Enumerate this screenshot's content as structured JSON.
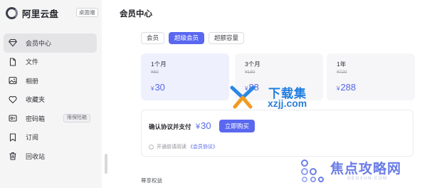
{
  "app": {
    "name": "阿里云盘",
    "edition_badge": "桌面端"
  },
  "sidebar": {
    "items": [
      {
        "label": "会员中心",
        "icon": "diamond-icon",
        "active": true
      },
      {
        "label": "文件",
        "icon": "file-icon"
      },
      {
        "label": "相册",
        "icon": "photo-icon"
      },
      {
        "label": "收藏夹",
        "icon": "heart-icon"
      },
      {
        "label": "密码箱",
        "icon": "safe-icon",
        "tag": "限保险箱"
      },
      {
        "label": "订阅",
        "icon": "bookmark-icon"
      },
      {
        "label": "回收站",
        "icon": "trash-icon"
      }
    ]
  },
  "main": {
    "title": "会员中心",
    "tabs": [
      {
        "label": "会员",
        "active": false
      },
      {
        "label": "超级会员",
        "active": true
      },
      {
        "label": "超额容量",
        "active": false
      }
    ],
    "plans": [
      {
        "name": "1个月",
        "original": "¥60",
        "currency": "¥",
        "price": "30",
        "selected": true
      },
      {
        "name": "3个月",
        "original": "¥180",
        "currency": "¥",
        "price": "88",
        "selected": false
      },
      {
        "name": "1年",
        "original": "¥720",
        "currency": "¥",
        "price": "288",
        "selected": false
      }
    ],
    "payment": {
      "label": "确认协议并支付",
      "currency": "¥",
      "price": "30",
      "button": "立即购买",
      "agree_text": "开通前请阅读",
      "agree_link": "《会员协议》"
    },
    "section_label": "尊享权益"
  },
  "watermarks": {
    "xzji": {
      "title": "下载集",
      "url": "xzjj.com"
    },
    "jiaodian": {
      "title": "焦点攻略网",
      "url": "GEOXUN.COM"
    }
  },
  "colors": {
    "accent": "#5a68f0",
    "price": "#5466e8",
    "sidebar_bg": "#f5f5f6",
    "selected_plan_bg": "#eef1fd"
  }
}
